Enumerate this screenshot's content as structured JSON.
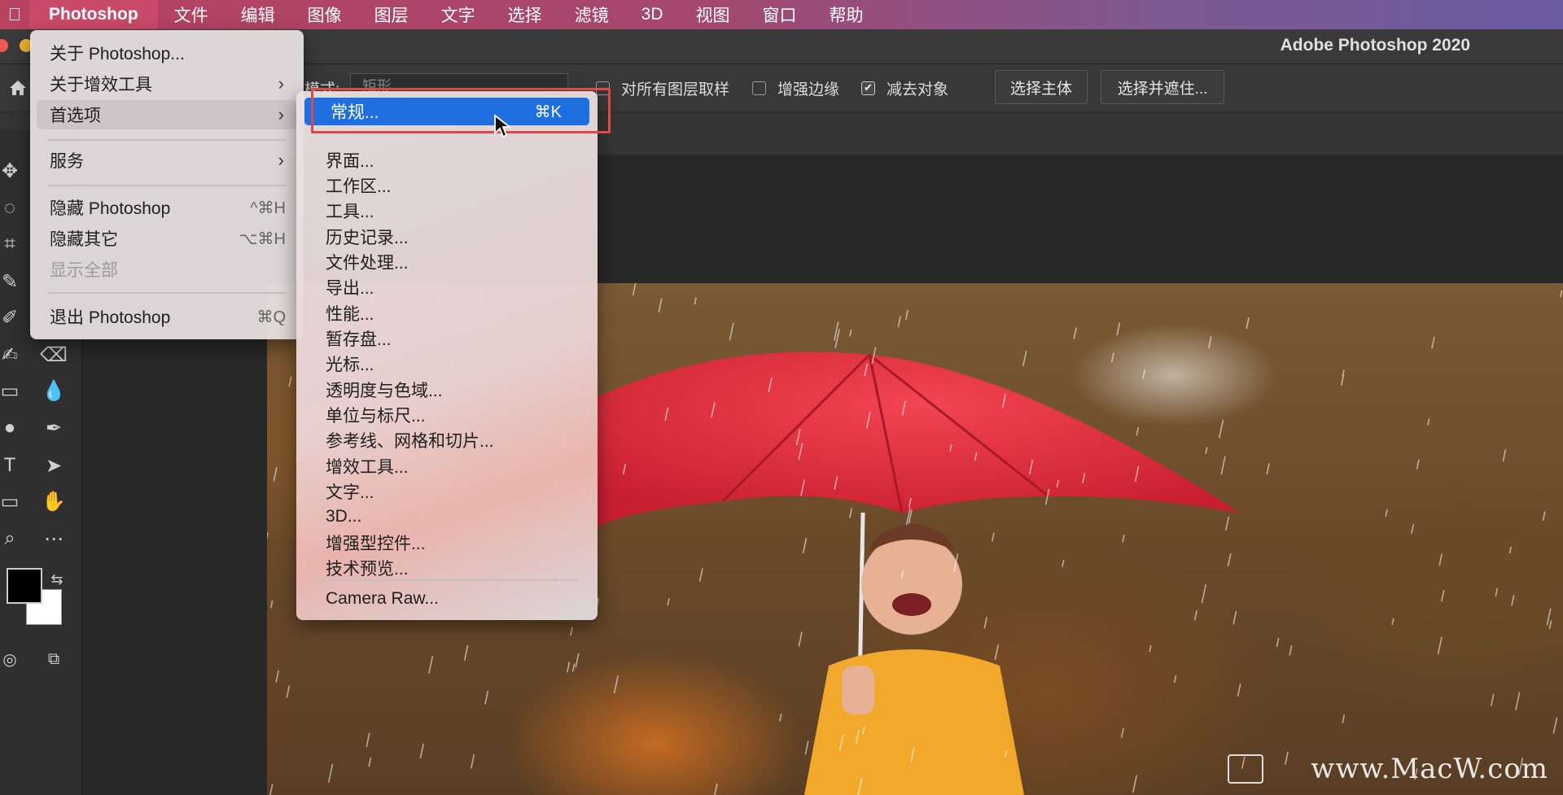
{
  "menubar": {
    "app": "Photoshop",
    "items": [
      "文件",
      "编辑",
      "图像",
      "图层",
      "文字",
      "选择",
      "滤镜",
      "3D",
      "视图",
      "窗口",
      "帮助"
    ]
  },
  "window": {
    "title": "Adobe Photoshop 2020"
  },
  "options": {
    "mode_label": "模式:",
    "mode_value": "矩形",
    "sample_all": "对所有图层取样",
    "enhance_edge": "增强边缘",
    "subtract": "减去对象",
    "select_subject": "选择主体",
    "select_mask": "选择并遮住..."
  },
  "ps_menu": {
    "items": [
      {
        "label": "关于 Photoshop..."
      },
      {
        "label": "关于增效工具"
      },
      {
        "label": "首选项"
      },
      {
        "label": "服务"
      },
      {
        "label": "隐藏 Photoshop",
        "shortcut": "^⌘H"
      },
      {
        "label": "隐藏其它",
        "shortcut": "⌥⌘H"
      },
      {
        "label": "显示全部"
      },
      {
        "label": "退出 Photoshop",
        "shortcut": "⌘Q"
      }
    ]
  },
  "prefs_menu": {
    "selected": {
      "label": "常规...",
      "shortcut": "⌘K"
    },
    "items": [
      "界面...",
      "工作区...",
      "工具...",
      "历史记录...",
      "文件处理...",
      "导出...",
      "性能...",
      "暂存盘...",
      "光标...",
      "透明度与色域...",
      "单位与标尺...",
      "参考线、网格和切片...",
      "增效工具...",
      "文字...",
      "3D...",
      "增强型控件...",
      "技术预览..."
    ],
    "camera_raw": "Camera Raw..."
  },
  "watermark": "www.MacW.com",
  "colors": {
    "accent": "#1f6fe0",
    "highlight_box": "#e04848",
    "umbrella": "#e8303f",
    "raincoat": "#f2a82a"
  }
}
